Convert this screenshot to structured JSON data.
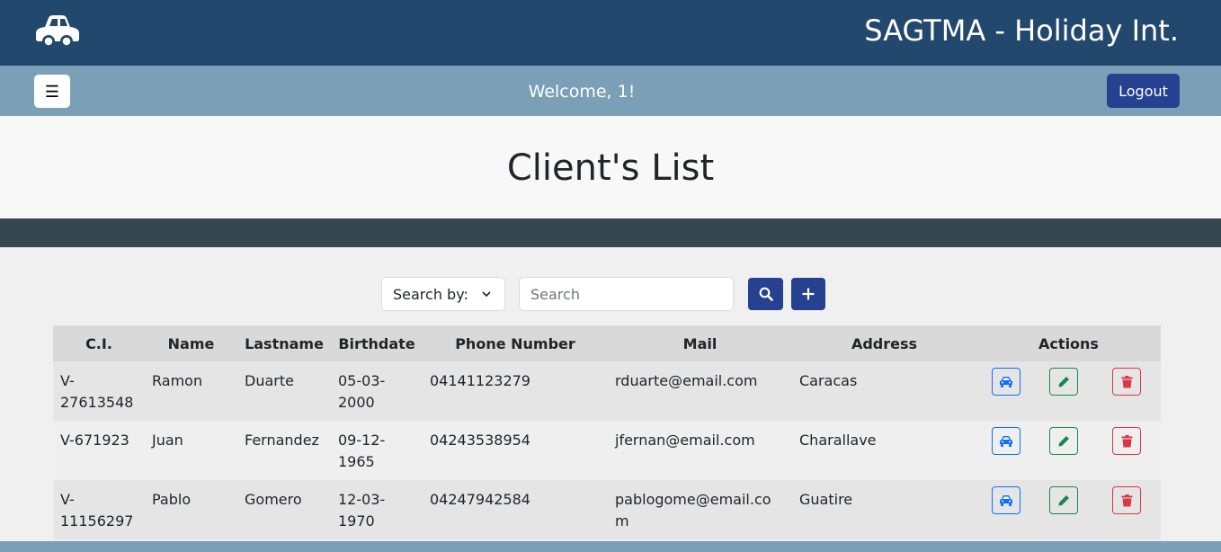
{
  "app": {
    "title": "SAGTMA - Holiday Int.",
    "logo_icon": "car-icon"
  },
  "navbar": {
    "menu_icon": "☰",
    "welcome": "Welcome, 1!",
    "logout_label": "Logout"
  },
  "page": {
    "title": "Client's List"
  },
  "search": {
    "select_label": "Search by:",
    "placeholder": "Search",
    "value": ""
  },
  "table": {
    "headers": [
      "C.I.",
      "Name",
      "Lastname",
      "Birthdate",
      "Phone Number",
      "Mail",
      "Address",
      "Actions"
    ],
    "rows": [
      {
        "ci": "V-27613548",
        "name": "Ramon",
        "lastname": "Duarte",
        "birthdate": "05-03-2000",
        "phone": "04141123279",
        "mail": "rduarte@email.com",
        "address": "Caracas"
      },
      {
        "ci": "V-671923",
        "name": "Juan",
        "lastname": "Fernandez",
        "birthdate": "09-12-1965",
        "phone": "04243538954",
        "mail": "jfernan@email.com",
        "address": "Charallave"
      },
      {
        "ci": "V-11156297",
        "name": "Pablo",
        "lastname": "Gomero",
        "birthdate": "12-03-1970",
        "phone": "04247942584",
        "mail": "pablogome@email.com",
        "address": "Guatire"
      }
    ]
  },
  "colors": {
    "topbar": "#22486e",
    "navbar": "#7b9fb6",
    "primary_button": "#25418f",
    "dark_band": "#37474f",
    "action_car": "#0d6efd",
    "action_edit": "#198754",
    "action_delete": "#dc3545"
  }
}
